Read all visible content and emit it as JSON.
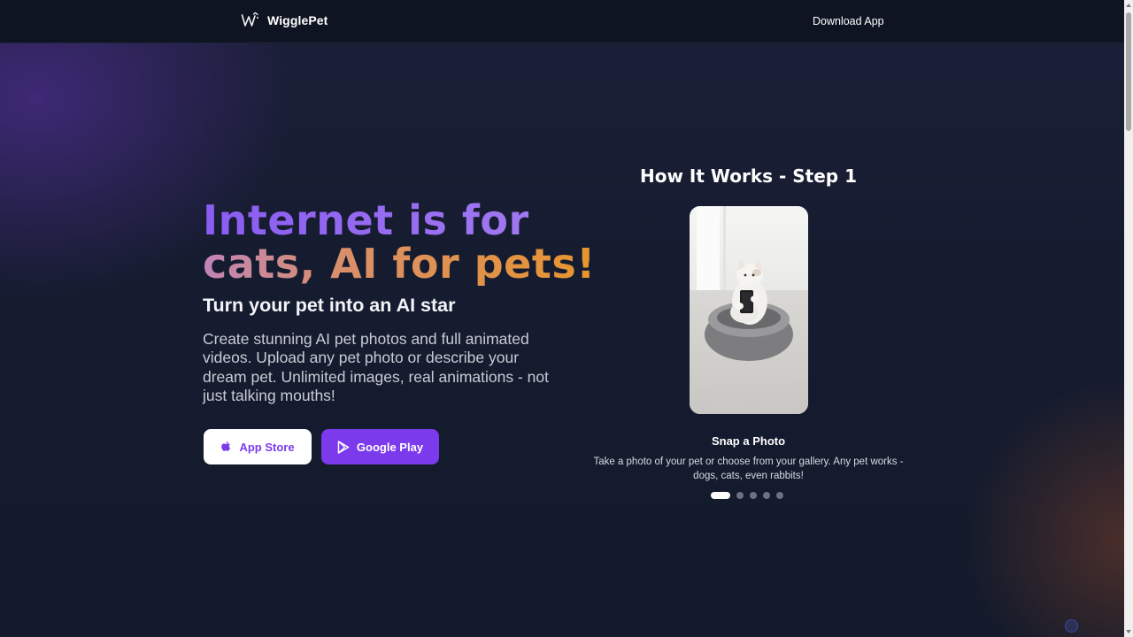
{
  "header": {
    "brand": "WigglePet",
    "download_link": "Download App"
  },
  "hero": {
    "title_line1": "Internet is for",
    "title_line2": "cats, AI for pets!",
    "subtitle": "Turn your pet into an AI star",
    "description": "Create stunning AI pet photos and full animated videos. Upload any pet photo or describe your dream pet. Unlimited images, real animations - not just talking mouths!",
    "buttons": {
      "app_store": "App Store",
      "google_play": "Google Play"
    }
  },
  "how_it_works": {
    "title": "How It Works - Step 1",
    "step_title": "Snap a Photo",
    "step_description": "Take a photo of your pet or choose from your gallery. Any pet works - dogs, cats, even rabbits!",
    "current_step": 1,
    "total_steps": 5
  },
  "colors": {
    "accent": "#7c3aed",
    "background": "#131a2b",
    "header": "#0f1422",
    "gradient_orange": "#e8952e"
  },
  "icons": {
    "logo": "wigglepet-logo-icon",
    "app_store": "apple-icon",
    "google_play": "google-play-icon"
  }
}
